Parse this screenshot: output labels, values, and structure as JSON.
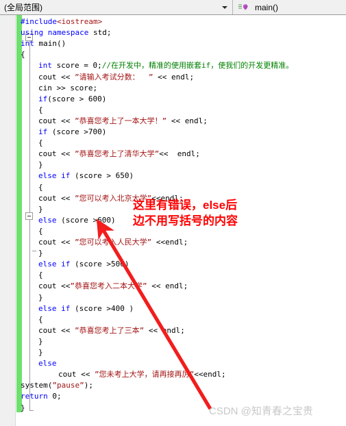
{
  "navbar": {
    "scope_label": "(全局范围)",
    "scope_arrow_icon": "chevron-down-icon",
    "member_label": "main()",
    "member_icon": "method-purple-icon"
  },
  "editor": {
    "language": "C++",
    "colors": {
      "keyword": "#0000ff",
      "string": "#a31515",
      "comment": "#008000",
      "plain": "#000000",
      "background": "#ffffff",
      "change_track": "#6fe06f",
      "annotation": "#ff0000",
      "watermark": "#c8c8c8"
    },
    "lines": [
      {
        "n": 1,
        "indent": 0,
        "tokens": [
          {
            "t": "#include",
            "c": "pp"
          },
          {
            "t": "<iostream>",
            "c": "ang"
          }
        ]
      },
      {
        "n": 2,
        "indent": 0,
        "tokens": [
          {
            "t": "using",
            "c": "kw"
          },
          {
            "t": " ",
            "c": "pl"
          },
          {
            "t": "namespace",
            "c": "kw"
          },
          {
            "t": " std;",
            "c": "pl"
          }
        ]
      },
      {
        "n": 3,
        "indent": 0,
        "tokens": [
          {
            "t": "int",
            "c": "kw"
          },
          {
            "t": " main()",
            "c": "pl"
          }
        ]
      },
      {
        "n": 4,
        "indent": 0,
        "tokens": [
          {
            "t": "{",
            "c": "pl"
          }
        ]
      },
      {
        "n": 5,
        "indent": 1,
        "tokens": [
          {
            "t": "int",
            "c": "kw"
          },
          {
            "t": " score = 0;",
            "c": "pl"
          },
          {
            "t": "//在开发中，精准的使用嵌套if，使我们的开发更精准。",
            "c": "cmt"
          }
        ]
      },
      {
        "n": 6,
        "indent": 1,
        "tokens": [
          {
            "t": "cout << ",
            "c": "pl"
          },
          {
            "t": "”请输入考试分数：  ”",
            "c": "str"
          },
          {
            "t": " << endl;",
            "c": "pl"
          }
        ]
      },
      {
        "n": 7,
        "indent": 1,
        "tokens": [
          {
            "t": "cin >> score;",
            "c": "pl"
          }
        ]
      },
      {
        "n": 8,
        "indent": 1,
        "tokens": [
          {
            "t": "if",
            "c": "kw"
          },
          {
            "t": "(score > 600)",
            "c": "pl"
          }
        ]
      },
      {
        "n": 9,
        "indent": 1,
        "tokens": [
          {
            "t": "{",
            "c": "pl"
          }
        ]
      },
      {
        "n": 10,
        "indent": 1,
        "tokens": [
          {
            "t": "cout << ",
            "c": "pl"
          },
          {
            "t": "”恭喜您考上了一本大学！”",
            "c": "str"
          },
          {
            "t": " << endl;",
            "c": "pl"
          }
        ]
      },
      {
        "n": 11,
        "indent": 1,
        "tokens": [
          {
            "t": "if",
            "c": "kw"
          },
          {
            "t": " (score >700)",
            "c": "pl"
          }
        ]
      },
      {
        "n": 12,
        "indent": 1,
        "tokens": [
          {
            "t": "{",
            "c": "pl"
          }
        ]
      },
      {
        "n": 13,
        "indent": 1,
        "tokens": [
          {
            "t": "cout << ",
            "c": "pl"
          },
          {
            "t": "”恭喜您考上了清华大学”",
            "c": "str"
          },
          {
            "t": "<<  endl;",
            "c": "pl"
          }
        ]
      },
      {
        "n": 14,
        "indent": 1,
        "tokens": [
          {
            "t": "}",
            "c": "pl"
          }
        ]
      },
      {
        "n": 15,
        "indent": 1,
        "tokens": [
          {
            "t": "else",
            "c": "kw"
          },
          {
            "t": " ",
            "c": "pl"
          },
          {
            "t": "if",
            "c": "kw"
          },
          {
            "t": " (score > 650)",
            "c": "pl"
          }
        ]
      },
      {
        "n": 16,
        "indent": 1,
        "tokens": [
          {
            "t": "{",
            "c": "pl"
          }
        ]
      },
      {
        "n": 17,
        "indent": 1,
        "tokens": [
          {
            "t": "cout << ",
            "c": "pl"
          },
          {
            "t": "”您可以考入北京大学”",
            "c": "str"
          },
          {
            "t": "<<endl;",
            "c": "pl"
          }
        ]
      },
      {
        "n": 18,
        "indent": 1,
        "tokens": [
          {
            "t": "}",
            "c": "pl"
          }
        ]
      },
      {
        "n": 19,
        "indent": 1,
        "tokens": [
          {
            "t": "else",
            "c": "kw"
          },
          {
            "t": " (score >600)",
            "c": "pl"
          }
        ]
      },
      {
        "n": 20,
        "indent": 1,
        "tokens": [
          {
            "t": "{",
            "c": "pl"
          }
        ]
      },
      {
        "n": 21,
        "indent": 1,
        "tokens": [
          {
            "t": "cout << ",
            "c": "pl"
          },
          {
            "t": "”您可以考入人民大学”",
            "c": "str"
          },
          {
            "t": " <<endl;",
            "c": "pl"
          }
        ]
      },
      {
        "n": 22,
        "indent": 1,
        "tokens": [
          {
            "t": "}",
            "c": "pl"
          }
        ]
      },
      {
        "n": 23,
        "indent": 1,
        "tokens": [
          {
            "t": "else",
            "c": "kw"
          },
          {
            "t": " ",
            "c": "pl"
          },
          {
            "t": "if",
            "c": "kw"
          },
          {
            "t": " (score >500)",
            "c": "pl"
          }
        ]
      },
      {
        "n": 24,
        "indent": 1,
        "tokens": [
          {
            "t": "{",
            "c": "pl"
          }
        ]
      },
      {
        "n": 25,
        "indent": 1,
        "tokens": [
          {
            "t": "cout <<",
            "c": "pl"
          },
          {
            "t": "”恭喜您考入二本大学”",
            "c": "str"
          },
          {
            "t": " << endl;",
            "c": "pl"
          }
        ]
      },
      {
        "n": 26,
        "indent": 1,
        "tokens": [
          {
            "t": "}",
            "c": "pl"
          }
        ]
      },
      {
        "n": 27,
        "indent": 1,
        "tokens": [
          {
            "t": "else",
            "c": "kw"
          },
          {
            "t": " ",
            "c": "pl"
          },
          {
            "t": "if",
            "c": "kw"
          },
          {
            "t": " (score >400 )",
            "c": "pl"
          }
        ]
      },
      {
        "n": 28,
        "indent": 1,
        "tokens": [
          {
            "t": "{",
            "c": "pl"
          }
        ]
      },
      {
        "n": 29,
        "indent": 1,
        "tokens": [
          {
            "t": "cout << ",
            "c": "pl"
          },
          {
            "t": "”恭喜您考上了三本”",
            "c": "str"
          },
          {
            "t": " << endl;",
            "c": "pl"
          }
        ]
      },
      {
        "n": 30,
        "indent": 1,
        "tokens": [
          {
            "t": "}",
            "c": "pl"
          }
        ]
      },
      {
        "n": 31,
        "indent": 1,
        "tokens": [
          {
            "t": "}",
            "c": "pl"
          }
        ]
      },
      {
        "n": 32,
        "indent": 1,
        "tokens": [
          {
            "t": "else",
            "c": "kw"
          }
        ]
      },
      {
        "n": 33,
        "indent": 2,
        "tokens": [
          {
            "t": "cout << ",
            "c": "pl"
          },
          {
            "t": "”您未考上大学，请再接再厉”",
            "c": "str"
          },
          {
            "t": "<<endl;",
            "c": "pl"
          }
        ]
      },
      {
        "n": 34,
        "indent": 0,
        "tokens": [
          {
            "t": "system(",
            "c": "pl"
          },
          {
            "t": "”pause”",
            "c": "str"
          },
          {
            "t": ");",
            "c": "pl"
          }
        ]
      },
      {
        "n": 35,
        "indent": 0,
        "tokens": [
          {
            "t": "return",
            "c": "kw"
          },
          {
            "t": " 0;",
            "c": "pl"
          }
        ]
      },
      {
        "n": 36,
        "indent": 0,
        "tokens": [
          {
            "t": "}",
            "c": "pl"
          }
        ]
      }
    ]
  },
  "annotation": {
    "line1": "这里有错误，else后",
    "line2": "边不用写括号的内容",
    "arrow_icon": "red-arrow-icon"
  },
  "watermark": {
    "text": "CSDN @知青春之宝贵"
  }
}
